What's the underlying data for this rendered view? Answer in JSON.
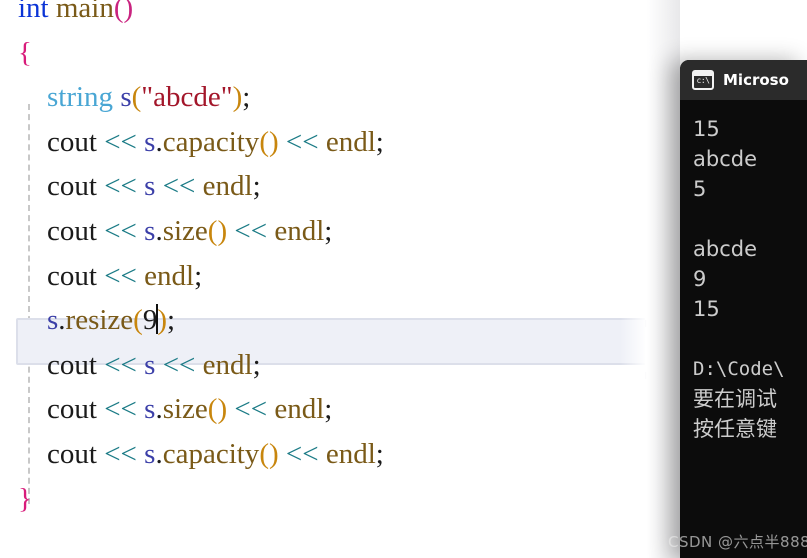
{
  "app": {
    "kind": "ide-editor-with-console"
  },
  "editor": {
    "language": "C++",
    "current_line_index": 6,
    "caret_after_text": "9",
    "lines": [
      {
        "id": "line-partial-top",
        "tokens": []
      },
      {
        "id": "line-int-main",
        "tokens": [
          {
            "t": "int",
            "c": "kw"
          },
          {
            "t": " ",
            "c": "plain"
          },
          {
            "t": "main",
            "c": "fn"
          },
          {
            "t": "()",
            "c": "paren"
          }
        ]
      },
      {
        "id": "line-open-brace",
        "tokens": [
          {
            "t": "{",
            "c": "brace"
          }
        ]
      },
      {
        "id": "line-string-decl",
        "tokens": [
          {
            "t": "    ",
            "c": "plain"
          },
          {
            "t": "string",
            "c": "type"
          },
          {
            "t": " ",
            "c": "plain"
          },
          {
            "t": "s",
            "c": "var"
          },
          {
            "t": "(",
            "c": "paren2"
          },
          {
            "t": "\"abcde\"",
            "c": "str"
          },
          {
            "t": ")",
            "c": "paren2"
          },
          {
            "t": ";",
            "c": "punct"
          }
        ]
      },
      {
        "id": "line-cout-capacity-1",
        "tokens": [
          {
            "t": "    ",
            "c": "plain"
          },
          {
            "t": "cout",
            "c": "plain"
          },
          {
            "t": " ",
            "c": "plain"
          },
          {
            "t": "<<",
            "c": "op"
          },
          {
            "t": " ",
            "c": "plain"
          },
          {
            "t": "s",
            "c": "var"
          },
          {
            "t": ".",
            "c": "punct"
          },
          {
            "t": "capacity",
            "c": "fn"
          },
          {
            "t": "()",
            "c": "paren2"
          },
          {
            "t": " ",
            "c": "plain"
          },
          {
            "t": "<<",
            "c": "op"
          },
          {
            "t": " ",
            "c": "plain"
          },
          {
            "t": "endl",
            "c": "fn"
          },
          {
            "t": ";",
            "c": "punct"
          }
        ]
      },
      {
        "id": "line-cout-s-1",
        "tokens": [
          {
            "t": "    ",
            "c": "plain"
          },
          {
            "t": "cout",
            "c": "plain"
          },
          {
            "t": " ",
            "c": "plain"
          },
          {
            "t": "<<",
            "c": "op"
          },
          {
            "t": " ",
            "c": "plain"
          },
          {
            "t": "s",
            "c": "var"
          },
          {
            "t": " ",
            "c": "plain"
          },
          {
            "t": "<<",
            "c": "op"
          },
          {
            "t": " ",
            "c": "plain"
          },
          {
            "t": "endl",
            "c": "fn"
          },
          {
            "t": ";",
            "c": "punct"
          }
        ]
      },
      {
        "id": "line-cout-size-1",
        "tokens": [
          {
            "t": "    ",
            "c": "plain"
          },
          {
            "t": "cout",
            "c": "plain"
          },
          {
            "t": " ",
            "c": "plain"
          },
          {
            "t": "<<",
            "c": "op"
          },
          {
            "t": " ",
            "c": "plain"
          },
          {
            "t": "s",
            "c": "var"
          },
          {
            "t": ".",
            "c": "punct"
          },
          {
            "t": "size",
            "c": "fn"
          },
          {
            "t": "()",
            "c": "paren2"
          },
          {
            "t": " ",
            "c": "plain"
          },
          {
            "t": "<<",
            "c": "op"
          },
          {
            "t": " ",
            "c": "plain"
          },
          {
            "t": "endl",
            "c": "fn"
          },
          {
            "t": ";",
            "c": "punct"
          }
        ]
      },
      {
        "id": "line-cout-endl",
        "tokens": [
          {
            "t": "    ",
            "c": "plain"
          },
          {
            "t": "cout",
            "c": "plain"
          },
          {
            "t": " ",
            "c": "plain"
          },
          {
            "t": "<<",
            "c": "op"
          },
          {
            "t": " ",
            "c": "plain"
          },
          {
            "t": "endl",
            "c": "fn"
          },
          {
            "t": ";",
            "c": "punct"
          }
        ]
      },
      {
        "id": "line-resize",
        "tokens": [
          {
            "t": "    ",
            "c": "plain"
          },
          {
            "t": "s",
            "c": "var"
          },
          {
            "t": ".",
            "c": "punct"
          },
          {
            "t": "resize",
            "c": "fn"
          },
          {
            "t": "(",
            "c": "paren2"
          },
          {
            "t": "9",
            "c": "plain"
          },
          {
            "t": "CARET",
            "c": "caret"
          },
          {
            "t": ")",
            "c": "paren2"
          },
          {
            "t": ";",
            "c": "punct"
          }
        ]
      },
      {
        "id": "line-cout-s-2",
        "tokens": [
          {
            "t": "    ",
            "c": "plain"
          },
          {
            "t": "cout",
            "c": "plain"
          },
          {
            "t": " ",
            "c": "plain"
          },
          {
            "t": "<<",
            "c": "op"
          },
          {
            "t": " ",
            "c": "plain"
          },
          {
            "t": "s",
            "c": "var"
          },
          {
            "t": " ",
            "c": "plain"
          },
          {
            "t": "<<",
            "c": "op"
          },
          {
            "t": " ",
            "c": "plain"
          },
          {
            "t": "endl",
            "c": "fn"
          },
          {
            "t": ";",
            "c": "punct"
          }
        ]
      },
      {
        "id": "line-cout-size-2",
        "tokens": [
          {
            "t": "    ",
            "c": "plain"
          },
          {
            "t": "cout",
            "c": "plain"
          },
          {
            "t": " ",
            "c": "plain"
          },
          {
            "t": "<<",
            "c": "op"
          },
          {
            "t": " ",
            "c": "plain"
          },
          {
            "t": "s",
            "c": "var"
          },
          {
            "t": ".",
            "c": "punct"
          },
          {
            "t": "size",
            "c": "fn"
          },
          {
            "t": "()",
            "c": "paren2"
          },
          {
            "t": " ",
            "c": "plain"
          },
          {
            "t": "<<",
            "c": "op"
          },
          {
            "t": " ",
            "c": "plain"
          },
          {
            "t": "endl",
            "c": "fn"
          },
          {
            "t": ";",
            "c": "punct"
          }
        ]
      },
      {
        "id": "line-cout-capacity-2",
        "tokens": [
          {
            "t": "    ",
            "c": "plain"
          },
          {
            "t": "cout",
            "c": "plain"
          },
          {
            "t": " ",
            "c": "plain"
          },
          {
            "t": "<<",
            "c": "op"
          },
          {
            "t": " ",
            "c": "plain"
          },
          {
            "t": "s",
            "c": "var"
          },
          {
            "t": ".",
            "c": "punct"
          },
          {
            "t": "capacity",
            "c": "fn"
          },
          {
            "t": "()",
            "c": "paren2"
          },
          {
            "t": " ",
            "c": "plain"
          },
          {
            "t": "<<",
            "c": "op"
          },
          {
            "t": " ",
            "c": "plain"
          },
          {
            "t": "endl",
            "c": "fn"
          },
          {
            "t": ";",
            "c": "punct"
          }
        ]
      },
      {
        "id": "line-close-brace",
        "tokens": [
          {
            "t": "}",
            "c": "brace"
          }
        ]
      }
    ],
    "colors": {
      "keyword": "#0b34d6",
      "type": "#49a6d4",
      "function": "#7a5a18",
      "brace": "#d81b7a",
      "variable": "#3b3fa8",
      "string": "#a3162a",
      "operator": "#1b7b86",
      "paren_gold": "#c8860d",
      "plain": "#1b1b1b",
      "current_line_bg": "#eef0f7",
      "background": "#ffffff"
    }
  },
  "console": {
    "title": "Microso",
    "icon": "terminal-icon",
    "icon_glyph": "c:\\",
    "titlebar_color": "#2b2b2b",
    "background": "#0c0c0c",
    "text_color": "#cccccc",
    "output_lines": [
      "15",
      "abcde",
      "5",
      "",
      "abcde",
      "9",
      "15",
      "",
      "D:\\Code\\",
      "要在调试",
      "按任意键"
    ]
  },
  "watermark": {
    "text": "CSDN @六点半888"
  }
}
